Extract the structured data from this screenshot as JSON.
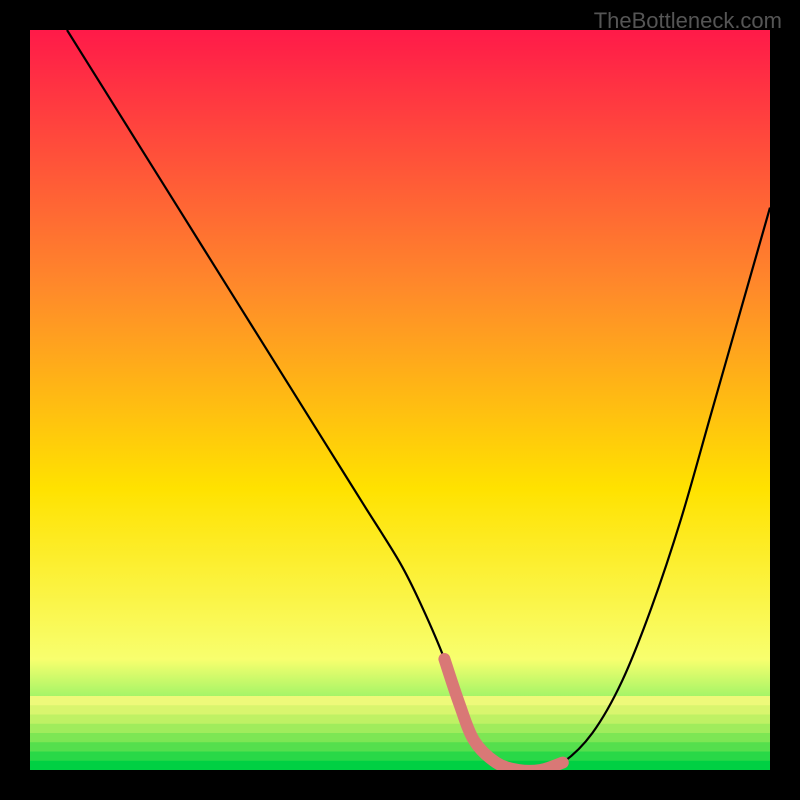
{
  "watermark": "TheBottleneck.com",
  "chart_data": {
    "type": "line",
    "title": "",
    "xlabel": "",
    "ylabel": "",
    "xlim": [
      0,
      100
    ],
    "ylim": [
      0,
      100
    ],
    "background_gradient": {
      "top": "#ff1a49",
      "mid1": "#ff8a2a",
      "mid2": "#ffe200",
      "low": "#f8ff6e",
      "bottom": "#00e05a"
    },
    "series": [
      {
        "name": "bottleneck-curve",
        "color": "#000000",
        "x": [
          5,
          10,
          15,
          20,
          25,
          30,
          35,
          40,
          45,
          50,
          53,
          56,
          58,
          60,
          63,
          66,
          69,
          72,
          76,
          80,
          84,
          88,
          92,
          96,
          100
        ],
        "values": [
          100,
          92,
          84,
          76,
          68,
          60,
          52,
          44,
          36,
          28,
          22,
          15,
          9,
          4,
          1,
          0,
          0,
          1,
          5,
          12,
          22,
          34,
          48,
          62,
          76
        ]
      }
    ],
    "highlight_band": {
      "color": "#d97876",
      "x_start": 56,
      "x_end": 72,
      "y_approx": 2
    }
  }
}
